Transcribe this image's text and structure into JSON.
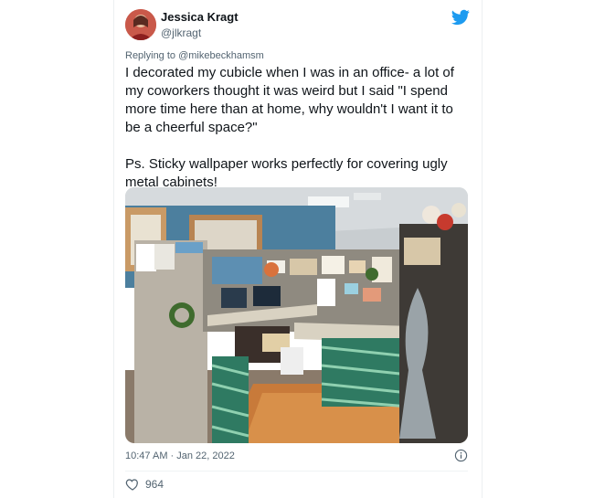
{
  "author": {
    "name": "Jessica Kragt",
    "handle": "@jlkragt"
  },
  "replying": {
    "prefix": "Replying to ",
    "mention": "@mikebeckhamsm"
  },
  "tweet": {
    "text": "I decorated my cubicle when I was in an office- a lot of my coworkers thought it was weird but I said \"I spend more time here than at home, why wouldn't I want it to be a cheerful space?\"\n\nPs. Sticky wallpaper works perfectly for covering ugly metal cabinets!"
  },
  "meta": {
    "timestamp": "10:47 AM · Jan 22, 2022"
  },
  "engagement": {
    "likes": "964"
  },
  "icons": {
    "brand": "twitter-bird-icon",
    "info": "info-icon",
    "like": "heart-icon"
  },
  "colors": {
    "twitter_blue": "#1d9bf0",
    "secondary_text": "#536471"
  }
}
